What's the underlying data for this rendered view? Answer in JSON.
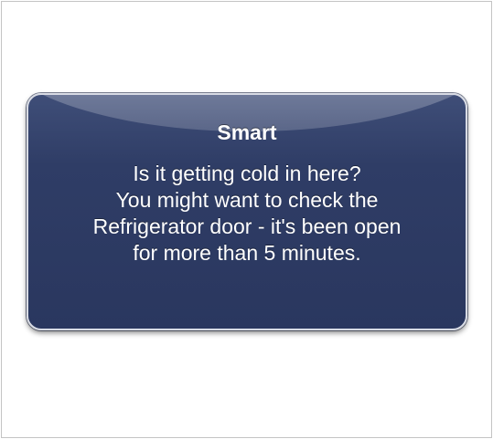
{
  "alert": {
    "title": "Smart",
    "message_lines": [
      "Is it getting cold in here?",
      "You might want to check the",
      "Refrigerator door - it's been open",
      "for more than 5 minutes."
    ]
  },
  "colors": {
    "alert_background": "#2f3d66",
    "alert_border": "#d8dbe4",
    "text": "#ffffff",
    "page_background": "#ffffff"
  }
}
